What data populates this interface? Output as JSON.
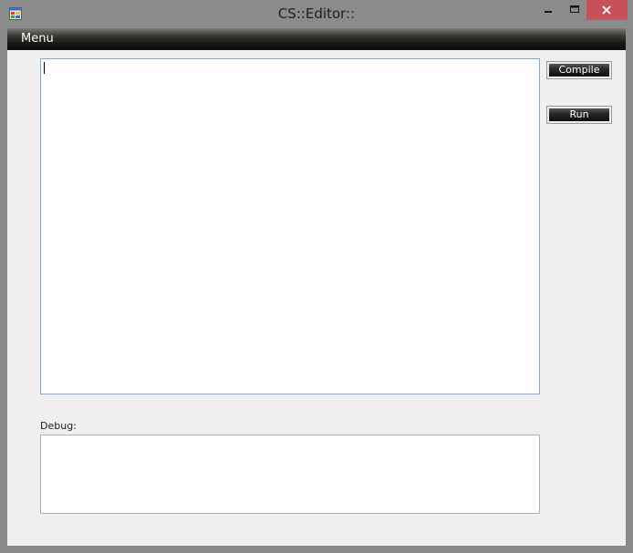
{
  "window": {
    "title": "CS::Editor::"
  },
  "menubar": {
    "items": [
      {
        "label": "Menu"
      }
    ]
  },
  "editor": {
    "value": ""
  },
  "debug": {
    "label": "Debug:",
    "value": ""
  },
  "buttons": {
    "compile": "Compile",
    "run": "Run"
  },
  "colors": {
    "close_button": "#c7505a",
    "menubar": "#181614",
    "editor_border": "#86a7c9"
  }
}
